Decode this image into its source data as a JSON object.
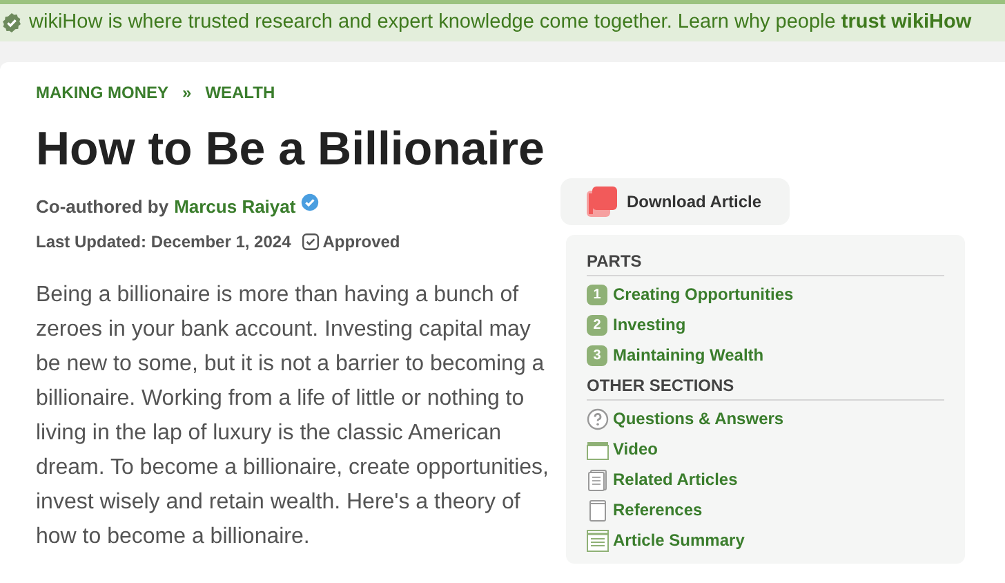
{
  "banner": {
    "text": "wikiHow is where trusted research and expert knowledge come together. Learn why people **trust wikiHow**"
  },
  "breadcrumbs": [
    "MAKING MONEY",
    "»",
    "WEALTH"
  ],
  "title": "How to Be a Billionaire",
  "byline": {
    "prefix": "Co-authored by",
    "author": "Marcus Raiyat"
  },
  "updated": {
    "text": "Last Updated: December 1, 2024",
    "badge": "Approved"
  },
  "intro": "Being a billionaire is more than having a bunch of zeroes in your bank account. Investing capital may be new to some, but it is not a barrier to becoming a billionaire. Working from a life of little or nothing to living in the lap of luxury is the classic American dream. To become a billionaire, create opportunities, invest wisely and retain wealth. Here's a theory of how to become a billionaire.",
  "download_button": {
    "label": "Download Article"
  },
  "toc": {
    "parts_heading": "PARTS",
    "parts": [
      {
        "number": "1",
        "label": "Creating Opportunities"
      },
      {
        "number": "2",
        "label": "Investing"
      },
      {
        "number": "3",
        "label": "Maintaining Wealth"
      }
    ],
    "other_heading": "OTHER SECTIONS",
    "other": [
      {
        "kind": "question",
        "label": "Questions & Answers"
      },
      {
        "kind": "video",
        "label": "Video"
      },
      {
        "kind": "document",
        "label": "Related Articles"
      },
      {
        "kind": "references",
        "label": "References"
      },
      {
        "kind": "summary",
        "label": "Article Summary"
      }
    ]
  }
}
